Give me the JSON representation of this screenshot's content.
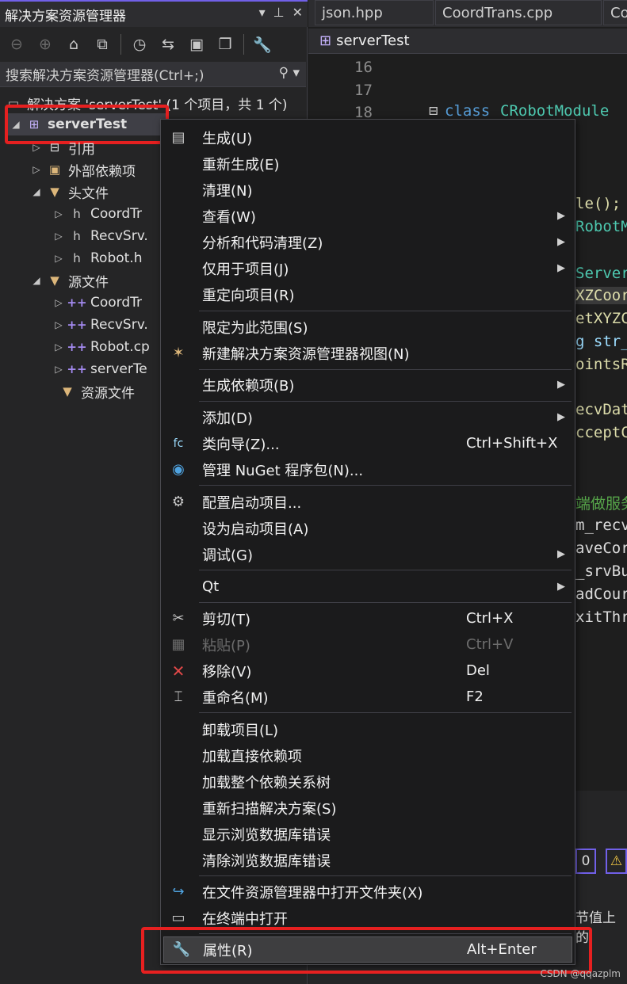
{
  "solution_explorer": {
    "title": "解决方案资源管理器",
    "search_placeholder": "搜索解决方案资源管理器(Ctrl+;)",
    "solution_label": "解决方案 'serverTest' (1 个项目，共 1 个)",
    "project_label": "serverTest",
    "tree": {
      "references": "引用",
      "external_deps": "外部依赖项",
      "header_files": "头文件",
      "h_coordtrans": "CoordTr",
      "h_recvsrv": "RecvSrv.",
      "h_robot": "Robot.h",
      "source_files": "源文件",
      "cpp_coordtrans": "CoordTr",
      "cpp_recvsrv": "RecvSrv.",
      "cpp_robot": "Robot.cp",
      "cpp_servertest": "serverTe",
      "resource_files": "资源文件"
    }
  },
  "editor": {
    "tabs": [
      "json.hpp",
      "CoordTrans.cpp",
      "Co"
    ],
    "file_tab": "serverTest",
    "line_numbers": [
      "16",
      "17",
      "18"
    ],
    "class_keyword": "class",
    "class_name": "CRobotModule",
    "fragments": [
      "le();",
      "RobotM",
      "Server",
      "XZCoord",
      "etXYZC",
      "g str_",
      "ointsR",
      "ecvDat",
      "cceptC",
      "端做服务",
      "m_recv",
      "aveCor",
      "_srvBu",
      "adCour",
      "xitThr"
    ],
    "bottom_text": "节值上的",
    "bottom_box": "0"
  },
  "context_menu": {
    "items": [
      {
        "label": "生成(U)",
        "icon": "build-icon"
      },
      {
        "label": "重新生成(E)"
      },
      {
        "label": "清理(N)"
      },
      {
        "label": "查看(W)",
        "submenu": true
      },
      {
        "label": "分析和代码清理(Z)",
        "submenu": true
      },
      {
        "label": "仅用于项目(J)",
        "submenu": true
      },
      {
        "label": "重定向项目(R)"
      },
      {
        "label": "限定为此范围(S)"
      },
      {
        "label": "新建解决方案资源管理器视图(N)",
        "icon": "new-view-icon"
      },
      {
        "label": "生成依赖项(B)",
        "submenu": true
      },
      {
        "label": "添加(D)",
        "submenu": true
      },
      {
        "label": "类向导(Z)...",
        "shortcut": "Ctrl+Shift+X",
        "icon": "class-wizard-icon"
      },
      {
        "label": "管理 NuGet 程序包(N)...",
        "icon": "nuget-icon"
      },
      {
        "label": "配置启动项目...",
        "icon": "gear-icon"
      },
      {
        "label": "设为启动项目(A)"
      },
      {
        "label": "调试(G)",
        "submenu": true
      },
      {
        "label": "Qt",
        "submenu": true
      },
      {
        "label": "剪切(T)",
        "shortcut": "Ctrl+X",
        "icon": "scissors-icon"
      },
      {
        "label": "粘贴(P)",
        "shortcut": "Ctrl+V",
        "icon": "paste-icon"
      },
      {
        "label": "移除(V)",
        "shortcut": "Del",
        "icon": "remove-icon"
      },
      {
        "label": "重命名(M)",
        "shortcut": "F2",
        "icon": "rename-icon"
      },
      {
        "label": "卸载项目(L)"
      },
      {
        "label": "加载直接依赖项"
      },
      {
        "label": "加载整个依赖关系树"
      },
      {
        "label": "重新扫描解决方案(S)"
      },
      {
        "label": "显示浏览数据库错误"
      },
      {
        "label": "清除浏览数据库错误"
      },
      {
        "label": "在文件资源管理器中打开文件夹(X)",
        "icon": "open-folder-icon"
      },
      {
        "label": "在终端中打开",
        "icon": "terminal-icon"
      },
      {
        "label": "属性(R)",
        "shortcut": "Alt+Enter",
        "icon": "wrench-icon"
      }
    ]
  },
  "watermark": "CSDN @qqazplm",
  "colors": {
    "accent": "#7160e8",
    "highlight_red": "#e62020",
    "menu_bg": "#1b1b1c",
    "panel_bg": "#252526"
  }
}
